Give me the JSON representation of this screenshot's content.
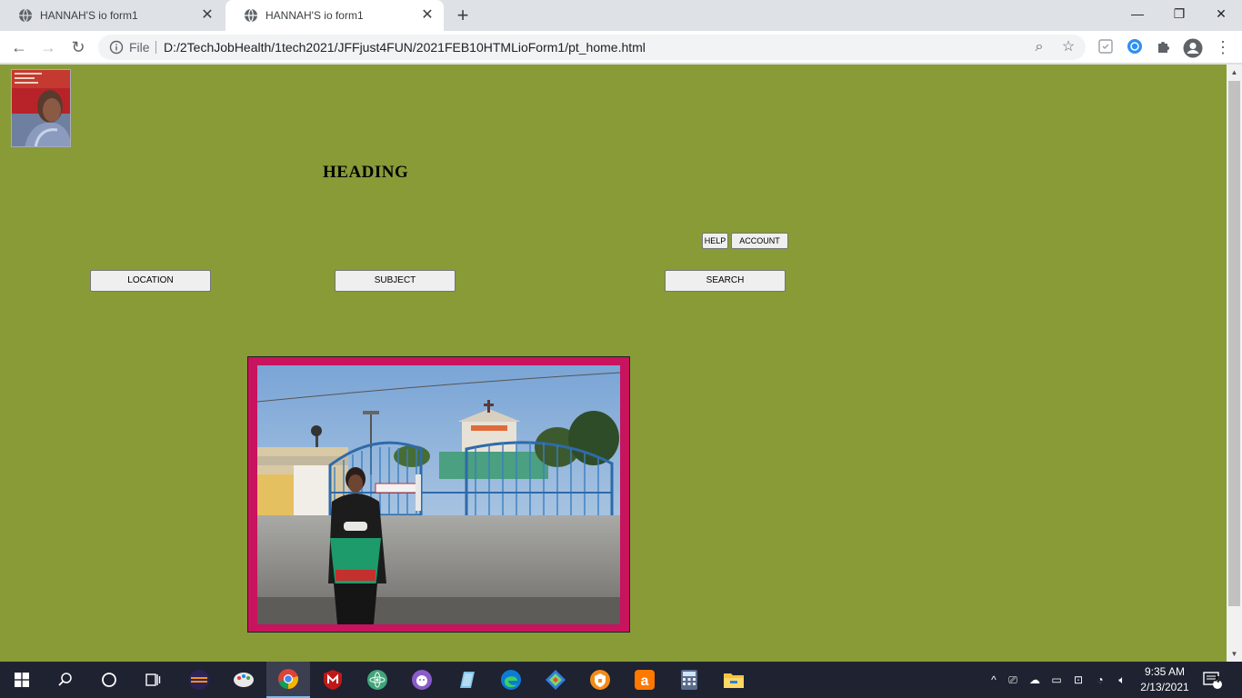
{
  "browser": {
    "tabs": [
      {
        "title": "HANNAH'S io form1",
        "active": false
      },
      {
        "title": "HANNAH'S io form1",
        "active": true
      }
    ],
    "new_tab_label": "+",
    "address": {
      "scheme_label": "File",
      "url": "D:/2TechJobHealth/1tech2021/JFFjust4FUN/2021FEB10HTMLioForm1/pt_home.html"
    }
  },
  "page": {
    "heading": "HEADING",
    "buttons": {
      "help": "HELP",
      "account": "ACCOUNT",
      "location": "LOCATION",
      "subject": "SUBJECT",
      "search": "SEARCH"
    },
    "background_color": "#889b37",
    "photo_frame_color": "#c8135e"
  },
  "taskbar": {
    "time": "9:35 AM",
    "date": "2/13/2021",
    "notification_count": "4",
    "apps": [
      "start-icon",
      "search-icon",
      "cortana-icon",
      "task-view-icon",
      "eclipse-icon",
      "paint-icon",
      "chrome-icon",
      "mcafee-icon",
      "atom-icon",
      "github-desktop-icon",
      "notepad-icon",
      "edge-icon",
      "sourcetree-icon",
      "avast-vpn-icon",
      "avast-icon",
      "calculator-icon",
      "file-explorer-icon"
    ]
  }
}
